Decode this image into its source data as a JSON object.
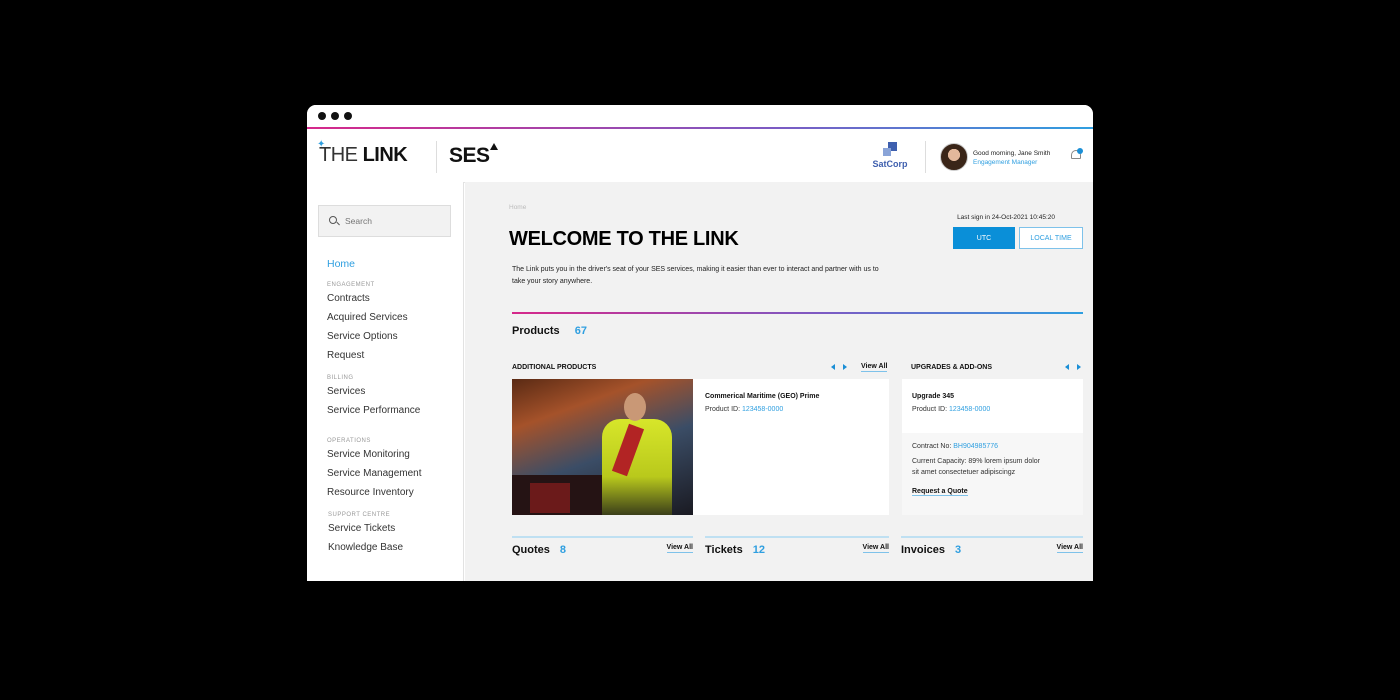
{
  "window": {
    "dots": 3
  },
  "header": {
    "logo": {
      "the": "THE",
      "link": "LINK",
      "brand": "SES"
    },
    "company": "SatCorp",
    "user": {
      "greeting": "Good morning, Jane Smith",
      "role": "Engagement Manager"
    },
    "notifications": {
      "icon": "bell-icon",
      "has_badge": true
    }
  },
  "sidebar": {
    "search_placeholder": "Search",
    "home": "Home",
    "sections": [
      {
        "label": "ENGAGEMENT",
        "items": [
          "Contracts",
          "Acquired Services",
          "Service Options",
          "Request"
        ]
      },
      {
        "label": "BILLING",
        "items": [
          "Services",
          "Service Performance"
        ]
      },
      {
        "label": "OPERATIONS",
        "items": [
          "Service Monitoring",
          "Service Management",
          "Resource Inventory"
        ]
      },
      {
        "label": "SUPPORT CENTRE",
        "items": [
          "Service Tickets",
          "Knowledge Base"
        ]
      }
    ]
  },
  "main": {
    "breadcrumb": "Home",
    "title": "WELCOME TO THE LINK",
    "intro": "The Link puts you in the driver's seat of your SES services, making it easier than ever to interact and partner with us to take your story anywhere.",
    "last_sign_in": "Last sign in 24-Oct-2021  10:45:20",
    "time_buttons": {
      "utc": "UTC",
      "local": "LOCAL TIME",
      "active": "UTC"
    },
    "products": {
      "label": "Products",
      "count": "67"
    },
    "additional_products": {
      "heading": "ADDITIONAL PRODUCTS",
      "view_all": "View All",
      "card": {
        "title": "Commerical Maritime (GEO) Prime",
        "product_id_label": "Product ID: ",
        "product_id": "123458-0000"
      }
    },
    "upgrades": {
      "heading": "UPGRADES & ADD-ONS",
      "card": {
        "title": "Upgrade 345",
        "product_id_label": "Product ID: ",
        "product_id": "123458-0000",
        "contract_label": "Contract No: ",
        "contract_no": "BH904985776",
        "capacity_line1": "Current Capacity: 89% lorem ipsum dolor",
        "capacity_line2": "sit amet consectetuer adipiscingz",
        "cta": "Request a Quote"
      }
    },
    "stats": [
      {
        "label": "Quotes",
        "count": "8",
        "view_all": "View All"
      },
      {
        "label": "Tickets",
        "count": "12",
        "view_all": "View All"
      },
      {
        "label": "Invoices",
        "count": "3",
        "view_all": "View All"
      }
    ]
  },
  "colors": {
    "accent": "#2f9fe0",
    "primary_button": "#0a8fd8",
    "gradient_start": "#d6288a",
    "gradient_end": "#2f9fe0"
  }
}
